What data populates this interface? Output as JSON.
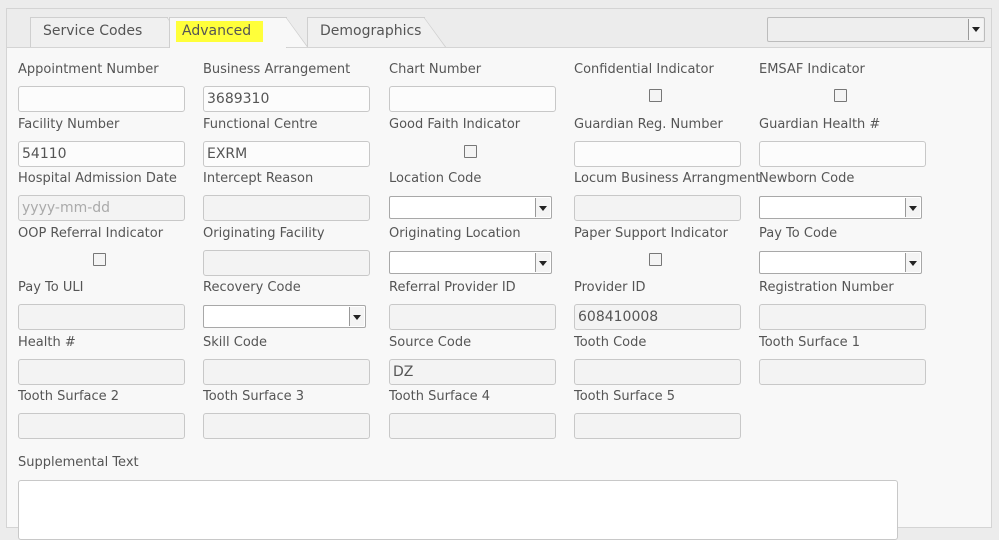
{
  "tabs": [
    {
      "label": "Service Codes",
      "active": false
    },
    {
      "label": "Advanced",
      "active": true,
      "highlight_color": "#ffff3a"
    },
    {
      "label": "Demographics",
      "active": false
    }
  ],
  "top_select": {
    "value": ""
  },
  "fields": {
    "appointment_number": {
      "label": "Appointment Number",
      "value": ""
    },
    "business_arrangement": {
      "label": "Business Arrangement",
      "value": "3689310"
    },
    "chart_number": {
      "label": "Chart Number",
      "value": ""
    },
    "confidential_indicator": {
      "label": "Confidential Indicator",
      "checked": false
    },
    "emsaf_indicator": {
      "label": "EMSAF Indicator",
      "checked": false
    },
    "facility_number": {
      "label": "Facility Number",
      "value": "54110"
    },
    "functional_centre": {
      "label": "Functional Centre",
      "value": "EXRM"
    },
    "good_faith_indicator": {
      "label": "Good Faith Indicator",
      "checked": false
    },
    "guardian_reg_number": {
      "label": "Guardian Reg. Number",
      "value": ""
    },
    "guardian_health": {
      "label": "Guardian Health #",
      "value": ""
    },
    "hospital_admission_date": {
      "label": "Hospital Admission Date",
      "value": "",
      "placeholder": "yyyy-mm-dd"
    },
    "intercept_reason": {
      "label": "Intercept Reason",
      "value": ""
    },
    "location_code": {
      "label": "Location Code",
      "value": ""
    },
    "locum_business_arrangment": {
      "label": "Locum Business Arrangment",
      "value": ""
    },
    "newborn_code": {
      "label": "Newborn Code",
      "value": ""
    },
    "oop_referral_indicator": {
      "label": "OOP Referral Indicator",
      "checked": false
    },
    "originating_facility": {
      "label": "Originating Facility",
      "value": ""
    },
    "originating_location": {
      "label": "Originating Location",
      "value": ""
    },
    "paper_support_indicator": {
      "label": "Paper Support Indicator",
      "checked": false
    },
    "pay_to_code": {
      "label": "Pay To Code",
      "value": ""
    },
    "pay_to_uli": {
      "label": "Pay To ULI",
      "value": ""
    },
    "recovery_code": {
      "label": "Recovery Code",
      "value": ""
    },
    "referral_provider_id": {
      "label": "Referral Provider ID",
      "value": ""
    },
    "provider_id": {
      "label": "Provider ID",
      "value": "608410008"
    },
    "registration_number": {
      "label": "Registration Number",
      "value": ""
    },
    "health_number": {
      "label": "Health #",
      "value": ""
    },
    "skill_code": {
      "label": "Skill Code",
      "value": ""
    },
    "source_code": {
      "label": "Source Code",
      "value": "DZ"
    },
    "tooth_code": {
      "label": "Tooth Code",
      "value": ""
    },
    "tooth_surface_1": {
      "label": "Tooth Surface 1",
      "value": ""
    },
    "tooth_surface_2": {
      "label": "Tooth Surface 2",
      "value": ""
    },
    "tooth_surface_3": {
      "label": "Tooth Surface 3",
      "value": ""
    },
    "tooth_surface_4": {
      "label": "Tooth Surface 4",
      "value": ""
    },
    "tooth_surface_5": {
      "label": "Tooth Surface 5",
      "value": ""
    },
    "supplemental_text": {
      "label": "Supplemental Text",
      "value": ""
    }
  }
}
